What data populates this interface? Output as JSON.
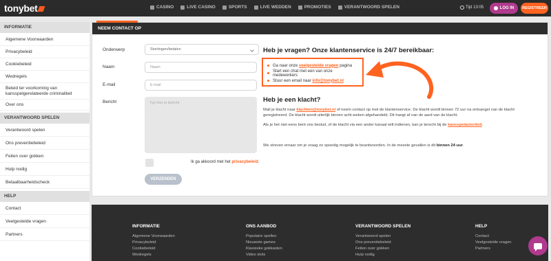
{
  "header": {
    "logo": "tonybet",
    "nav": [
      {
        "label": "CASINO",
        "icon": "casino-icon"
      },
      {
        "label": "LIVE CASINO",
        "icon": "live-casino-icon"
      },
      {
        "label": "SPORTS",
        "icon": "sports-icon"
      },
      {
        "label": "LIVE WEDDEN",
        "icon": "live-betting-icon"
      },
      {
        "label": "PROMOTIES",
        "icon": "gift-icon"
      },
      {
        "label": "VERANTWOORD SPELEN",
        "icon": "shield-icon"
      }
    ],
    "time": "Tijd 13:05",
    "login_label": "LOG IN",
    "register_label": "REGISTREER"
  },
  "sidebar": {
    "sections": [
      {
        "title": "INFORMATIE",
        "items": [
          "Algemene Voorwaarden",
          "Privacybeleid",
          "Cookiebeleid",
          "Wedregels",
          "Beleid ter voorkoming van kansspelgerelateerde criminaliteit",
          "Over ons"
        ]
      },
      {
        "title": "VERANTWOORD SPELEN",
        "items": [
          "Verantwoord spelen",
          "Ons preventiebeleid",
          "Feiten over gokken",
          "Hulp nodig",
          "Betaalbaarheidscheck"
        ]
      },
      {
        "title": "HELP",
        "items": [
          "Contact",
          "Veelgestelde vragen",
          "Partners"
        ]
      }
    ]
  },
  "contact": {
    "title": "NEEM CONTACT OP",
    "subject_label": "Onderwerp",
    "subject_value": "Stortingen/betalen",
    "name_label": "Naam",
    "name_placeholder": "Naam",
    "email_label": "E-mail",
    "email_placeholder": "E-mail",
    "message_label": "Bericht",
    "message_placeholder": "Typ hier je bericht",
    "agree_text": "Ik ga akkoord met het",
    "agree_link": "privacybeleid",
    "agree_end": ".",
    "send_label": "VERZENDEN"
  },
  "info": {
    "heading": "Heb je vragen? Onze klantenservice is 24/7 bereikbaar:",
    "row1_pre": "Ga naar onze",
    "row1_link": "veelgestelde vragen",
    "row1_post": "pagina",
    "row2": "Start een chat met een van onze medewerkers",
    "row3_pre": "Stuur een email naar",
    "row3_link": "info@tonybet.nl",
    "complaint_heading": "Heb je een klacht?",
    "complaint_p1_pre": "Mail je klacht naar",
    "complaint_p1_link": "klachten@tonybet.nl",
    "complaint_p1_post": "of neem contact op met de klantenservice. De klacht wordt binnen 72 uur na ontvangst van de klacht geregistreerd. De klacht wordt uiterlijk binnen acht weken afgehandeld. Dit hangt af van de aard van de klacht.",
    "complaint_p2_pre": "Als je het niet eens bent ons besluit, of de klacht via een ander kanaal wilt indienen, kan je terecht bij de",
    "complaint_p2_link": "kansspelautoriteit",
    "complaint_p2_end": ".",
    "complaint_p3_pre": "We streven ernaar om je vraag zo spoedig mogelijk te beantwoorden. In de meeste gevallen is dit",
    "complaint_p3_bold": "binnen 24 uur",
    "complaint_p3_end": "."
  },
  "footer": {
    "columns": [
      {
        "title": "INFORMATIE",
        "items": [
          "Algemene Voorwaarden",
          "Privacybeleid",
          "Cookiebeleid",
          "Wedregels"
        ]
      },
      {
        "title": "ONS AANBOD",
        "items": [
          "Populaire spellen",
          "Nieuwste games",
          "Klassieke gokkasten",
          "Video slots"
        ]
      },
      {
        "title": "VERANTWOORD SPELEN",
        "items": [
          "Verantwoord spelen",
          "Ons preventiebeleid",
          "Feiten over gokken",
          "Hulp nodig"
        ]
      },
      {
        "title": "HELP",
        "items": [
          "Contact",
          "Veelgestelde vragen",
          "Partners"
        ]
      }
    ]
  },
  "colors": {
    "accent": "#ff6320",
    "brand_purple": "#b03a8e",
    "dark": "#2d2d2d"
  }
}
